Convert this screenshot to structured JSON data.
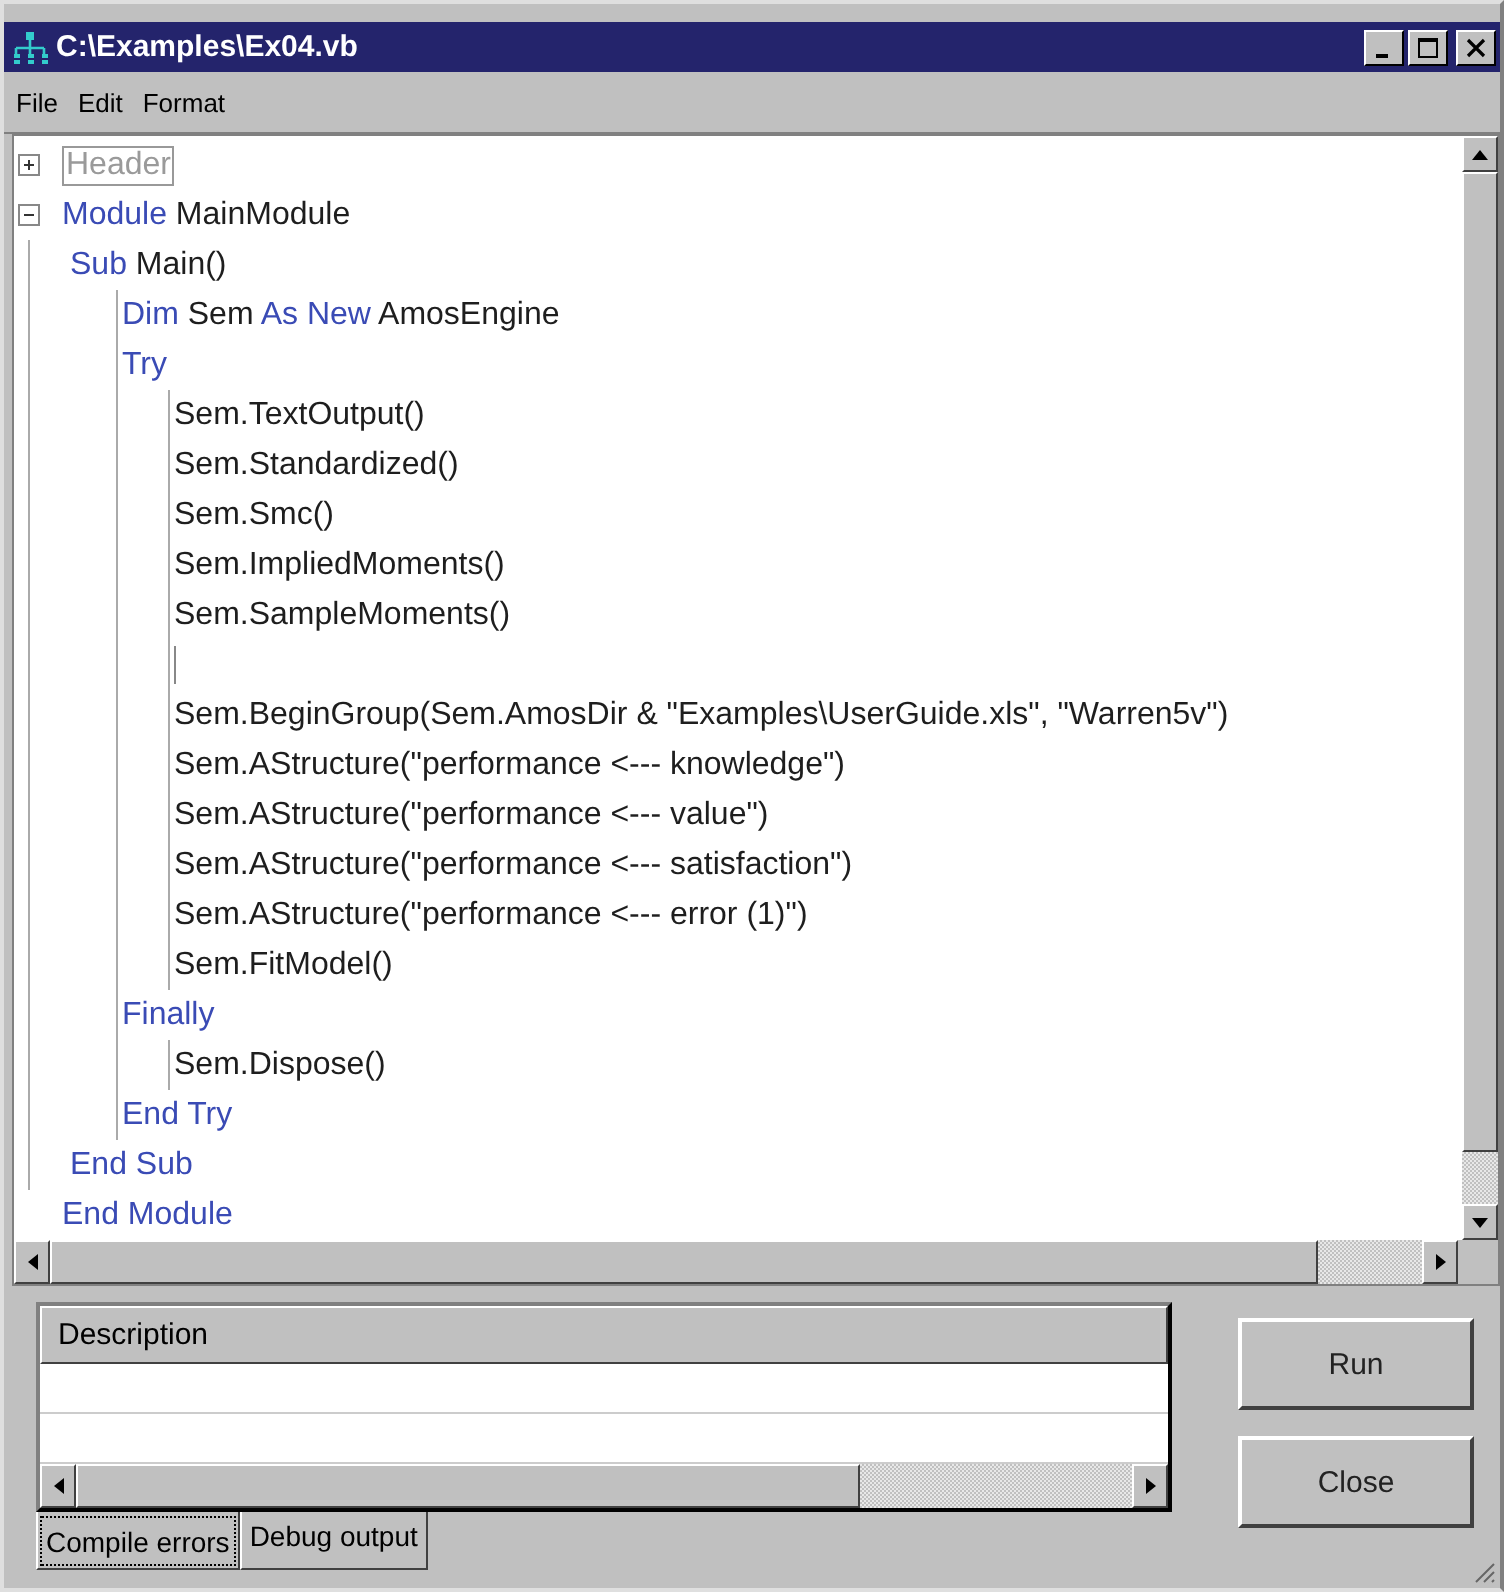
{
  "window": {
    "title": "C:\\Examples\\Ex04.vb"
  },
  "menu": [
    "File",
    "Edit",
    "Format"
  ],
  "code": [
    {
      "expanded": false,
      "segments": [
        {
          "kind": "label",
          "text": "Header"
        }
      ]
    },
    {
      "expanded": true,
      "segments": [
        {
          "kind": "keyword",
          "text": "Module"
        },
        {
          "kind": "plain",
          "text": " MainModule"
        }
      ],
      "children": [
        {
          "segments": [
            {
              "kind": "keyword",
              "text": "Sub"
            },
            {
              "kind": "plain",
              "text": " Main()"
            }
          ],
          "children": [
            {
              "segments": [
                {
                  "kind": "keyword",
                  "text": "Dim"
                },
                {
                  "kind": "plain",
                  "text": " Sem "
                },
                {
                  "kind": "keyword",
                  "text": "As New"
                },
                {
                  "kind": "plain",
                  "text": " AmosEngine"
                }
              ]
            },
            {
              "segments": [
                {
                  "kind": "keyword",
                  "text": "Try"
                }
              ],
              "children": [
                {
                  "segments": [
                    {
                      "kind": "plain",
                      "text": "Sem.TextOutput()"
                    }
                  ]
                },
                {
                  "segments": [
                    {
                      "kind": "plain",
                      "text": "Sem.Standardized()"
                    }
                  ]
                },
                {
                  "segments": [
                    {
                      "kind": "plain",
                      "text": "Sem.Smc()"
                    }
                  ]
                },
                {
                  "segments": [
                    {
                      "kind": "plain",
                      "text": "Sem.ImpliedMoments()"
                    }
                  ]
                },
                {
                  "segments": [
                    {
                      "kind": "plain",
                      "text": "Sem.SampleMoments()"
                    }
                  ]
                },
                {
                  "cursor": true
                },
                {
                  "segments": [
                    {
                      "kind": "plain",
                      "text": "Sem.BeginGroup(Sem.AmosDir & \"Examples\\UserGuide.xls\", \"Warren5v\")"
                    }
                  ]
                },
                {
                  "segments": [
                    {
                      "kind": "plain",
                      "text": "Sem.AStructure(\"performance <--- knowledge\")"
                    }
                  ]
                },
                {
                  "segments": [
                    {
                      "kind": "plain",
                      "text": "Sem.AStructure(\"performance <--- value\")"
                    }
                  ]
                },
                {
                  "segments": [
                    {
                      "kind": "plain",
                      "text": "Sem.AStructure(\"performance <--- satisfaction\")"
                    }
                  ]
                },
                {
                  "segments": [
                    {
                      "kind": "plain",
                      "text": "Sem.AStructure(\"performance <--- error (1)\")"
                    }
                  ]
                },
                {
                  "segments": [
                    {
                      "kind": "plain",
                      "text": "Sem.FitModel()"
                    }
                  ]
                }
              ]
            },
            {
              "segments": [
                {
                  "kind": "keyword",
                  "text": "Finally"
                }
              ],
              "children": [
                {
                  "segments": [
                    {
                      "kind": "plain",
                      "text": "Sem.Dispose()"
                    }
                  ]
                }
              ]
            },
            {
              "segments": [
                {
                  "kind": "keyword",
                  "text": "End Try"
                }
              ]
            }
          ]
        },
        {
          "segments": [
            {
              "kind": "keyword",
              "text": "End Sub"
            }
          ]
        }
      ]
    },
    {
      "segments": [
        {
          "kind": "keyword",
          "text": "End Module"
        }
      ]
    }
  ],
  "output": {
    "columns": [
      "Description"
    ]
  },
  "buttons": [
    "Run",
    "Close"
  ],
  "tabs": [
    {
      "label": "Compile errors",
      "selected": true
    },
    {
      "label": "Debug output",
      "selected": false
    }
  ]
}
